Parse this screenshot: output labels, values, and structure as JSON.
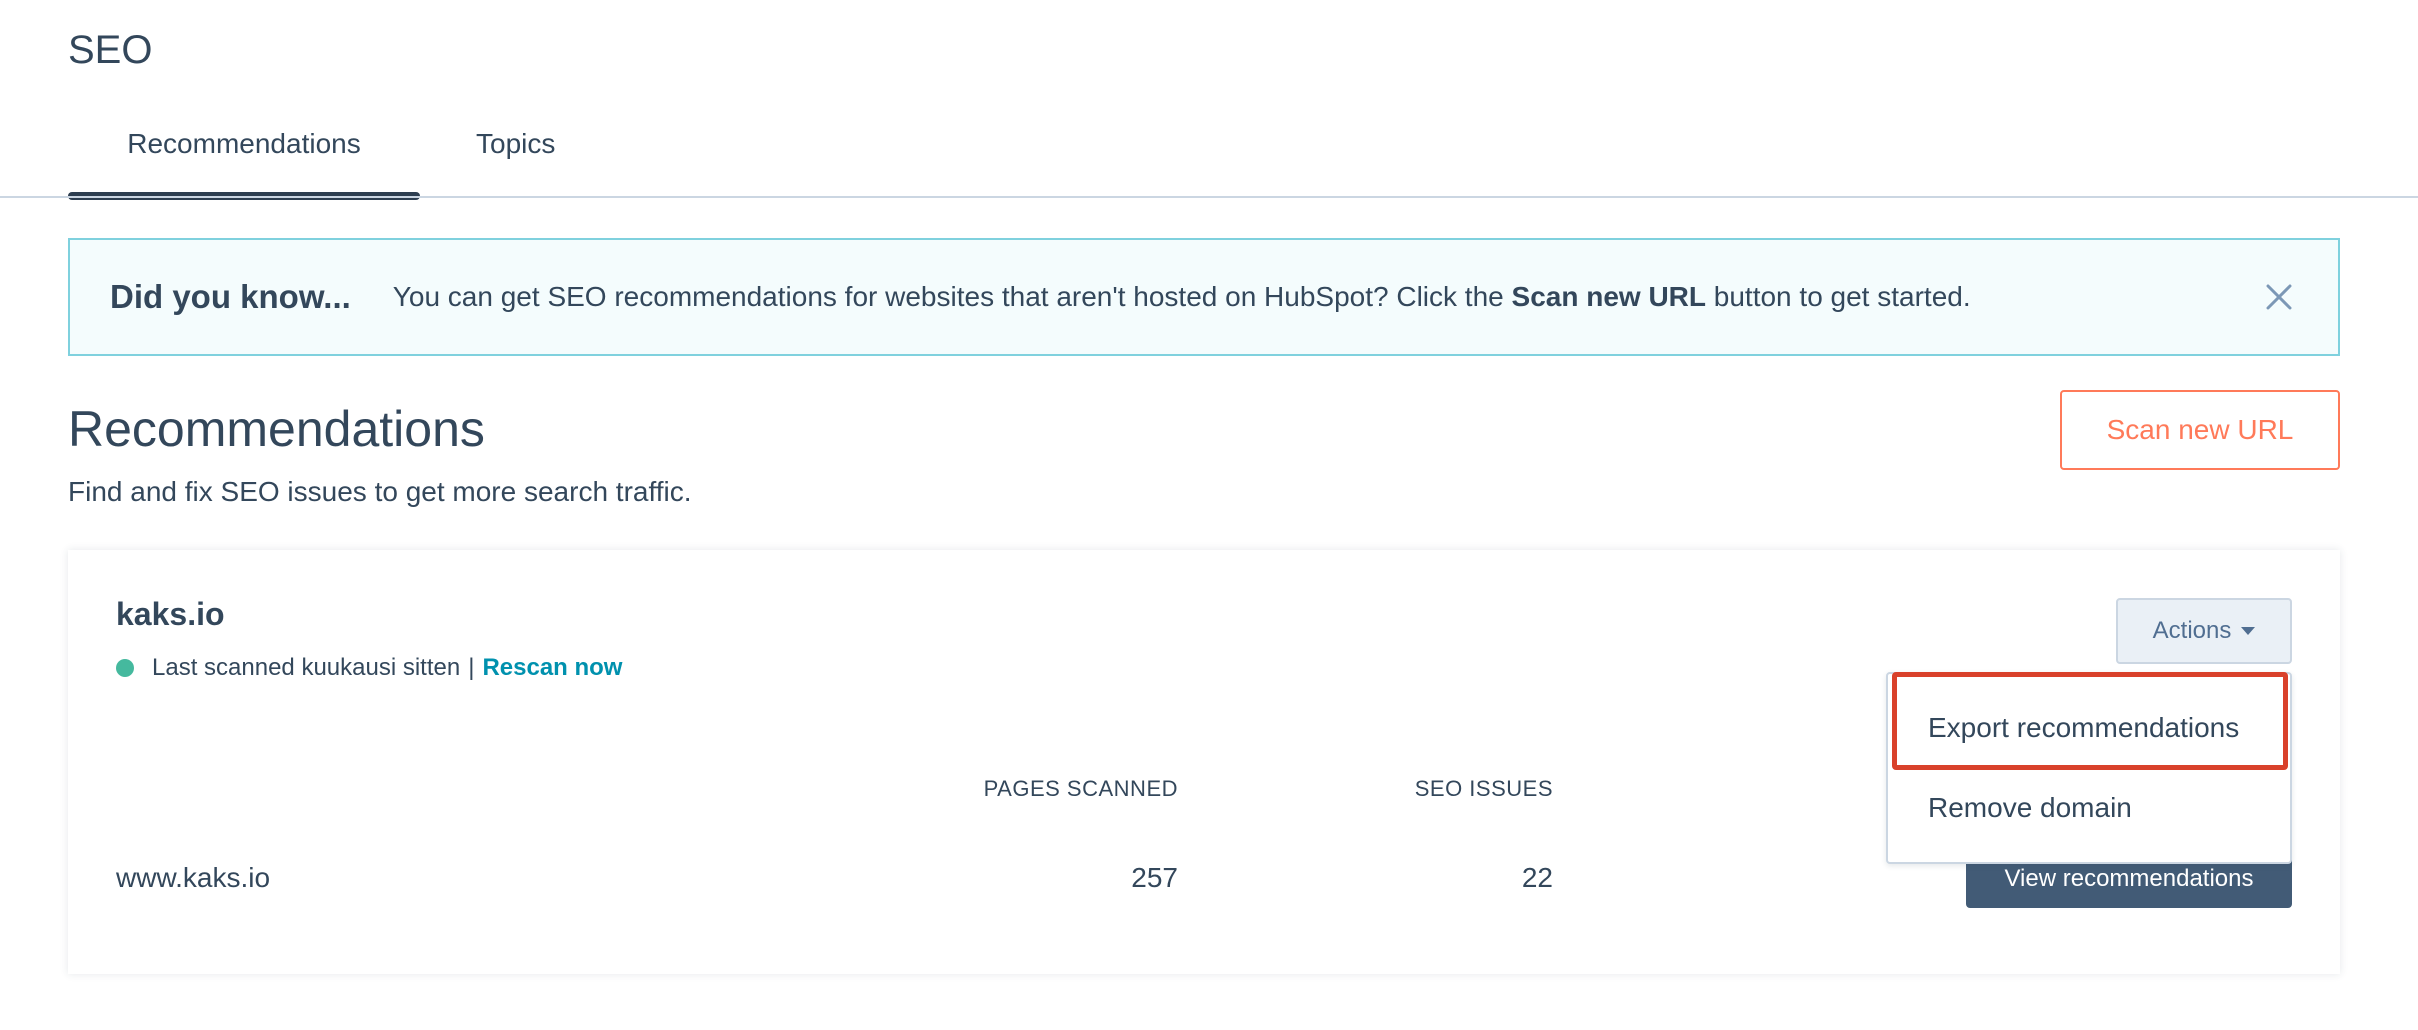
{
  "header": {
    "title": "SEO"
  },
  "tabs": [
    {
      "label": "Recommendations",
      "active": true
    },
    {
      "label": "Topics",
      "active": false
    }
  ],
  "alert": {
    "title": "Did you know...",
    "text_before": "You can get SEO recommendations for websites that aren't hosted on HubSpot? Click the",
    "text_bold": "Scan new URL",
    "text_after": "button to get started.",
    "close_icon": "close-icon"
  },
  "section": {
    "title": "Recommendations",
    "subtitle": "Find and fix SEO issues to get more search traffic.",
    "scan_button": "Scan new URL"
  },
  "card": {
    "domain": "kaks.io",
    "status_text": "Last scanned kuukausi sitten",
    "separator": "|",
    "rescan_link": "Rescan now",
    "actions_button": "Actions",
    "columns": {
      "pages": "PAGES SCANNED",
      "issues": "SEO ISSUES"
    },
    "rows": [
      {
        "url": "www.kaks.io",
        "pages": "257",
        "issues": "22",
        "button": "View recommendations"
      }
    ]
  },
  "dropdown": {
    "items": [
      {
        "label": "Export recommendations",
        "highlighted": true
      },
      {
        "label": "Remove domain",
        "highlighted": false
      }
    ]
  },
  "colors": {
    "primary_text": "#33475b",
    "accent_orange": "#ff7a59",
    "link_teal": "#0091ae",
    "status_green": "#45b99e",
    "highlight_red": "#d9412b"
  }
}
